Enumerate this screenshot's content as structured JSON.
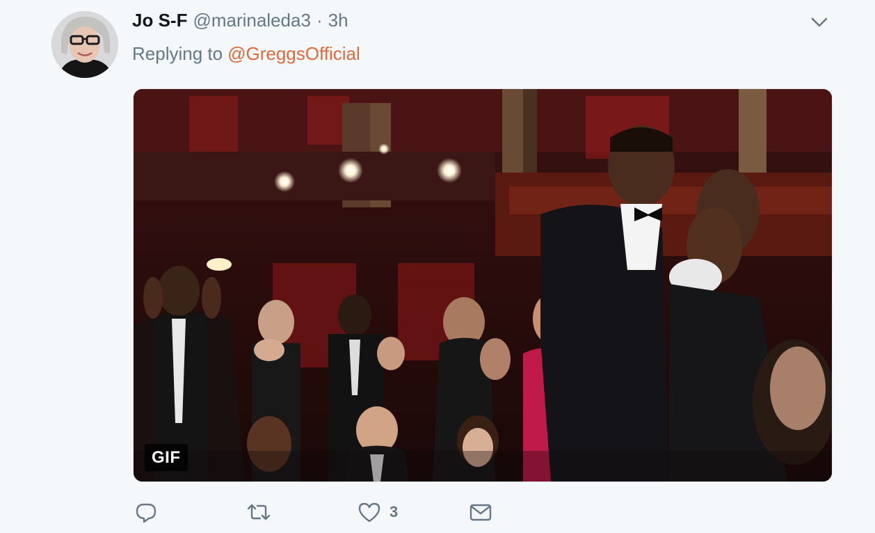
{
  "tweet": {
    "display_name": "Jo S-F",
    "handle": "@marinaleda3",
    "separator": "·",
    "timestamp": "3h",
    "replying_to_prefix": "Replying to",
    "replying_to_handle": "@GreggsOfficial",
    "media": {
      "badge": "GIF",
      "description_icon": "clapping-audience-gif"
    },
    "actions": {
      "reply": {
        "icon": "reply-icon",
        "count": ""
      },
      "retweet": {
        "icon": "retweet-icon",
        "count": ""
      },
      "like": {
        "icon": "heart-icon",
        "count": "3"
      },
      "dm": {
        "icon": "envelope-icon",
        "count": ""
      }
    }
  },
  "colors": {
    "background": "#f5f8fa",
    "text_primary": "#14171a",
    "text_secondary": "#657786",
    "link": "#e0693a"
  }
}
